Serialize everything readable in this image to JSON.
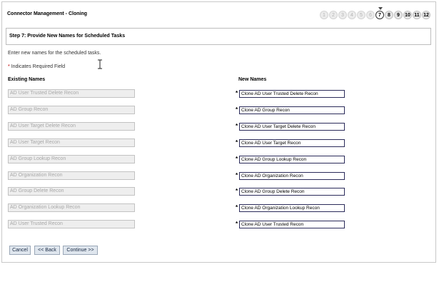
{
  "page": {
    "title": "Connector Management - Cloning",
    "step_header": "Step 7: Provide New Names for Scheduled Tasks",
    "instructions": "Enter new names for the scheduled tasks.",
    "required_star": "*",
    "required_note": "Indicates Required Field",
    "col_existing": "Existing Names",
    "col_new": "New Names"
  },
  "steps": [
    {
      "label": "1",
      "state": "past"
    },
    {
      "label": "2",
      "state": "past"
    },
    {
      "label": "3",
      "state": "past"
    },
    {
      "label": "4",
      "state": "past"
    },
    {
      "label": "5",
      "state": "past"
    },
    {
      "label": "6",
      "state": "past"
    },
    {
      "label": "7",
      "state": "current"
    },
    {
      "label": "8",
      "state": "future"
    },
    {
      "label": "9",
      "state": "future"
    },
    {
      "label": "10",
      "state": "future"
    },
    {
      "label": "11",
      "state": "future"
    },
    {
      "label": "12",
      "state": "future"
    }
  ],
  "tasks": [
    {
      "existing": "AD User Trusted Delete Recon",
      "new": "Clone AD User Trusted Delete Recon"
    },
    {
      "existing": "AD Group Recon",
      "new": "Clone AD Group Recon"
    },
    {
      "existing": "AD User Target Delete Recon",
      "new": "Clone AD User Target Delete Recon"
    },
    {
      "existing": "AD User Target Recon",
      "new": "Clone AD User Target Recon"
    },
    {
      "existing": "AD Group Lookup Recon",
      "new": "Clone AD Group Lookup Recon"
    },
    {
      "existing": "AD Organization Recon",
      "new": "Clone AD Organization Recon"
    },
    {
      "existing": "AD Group Delete Recon",
      "new": "Clone AD Group Delete Recon"
    },
    {
      "existing": "AD Organization Lookup Recon",
      "new": "Clone AD Organization Lookup Recon"
    },
    {
      "existing": "AD User Trusted Recon",
      "new": "Clone AD User Trusted Recon"
    }
  ],
  "buttons": {
    "cancel": "Cancel",
    "back": "<< Back",
    "continue": "Continue >>"
  }
}
